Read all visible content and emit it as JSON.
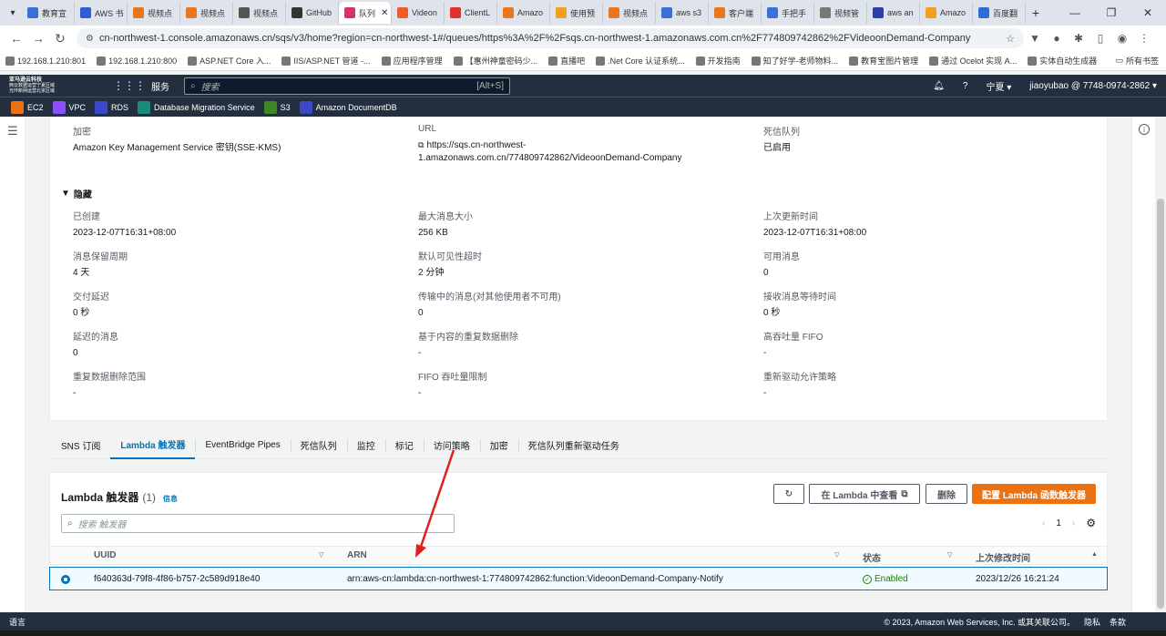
{
  "browser": {
    "tabs": [
      {
        "label": "教育宣",
        "color": "#3b6fd8"
      },
      {
        "label": "AWS 书",
        "color": "#2f5bd3"
      },
      {
        "label": "视频点",
        "color": "#e8761c"
      },
      {
        "label": "视频点",
        "color": "#e8761c"
      },
      {
        "label": "视频点",
        "color": "#555555"
      },
      {
        "label": "GitHub",
        "color": "#333333"
      },
      {
        "label": "队列",
        "color": "#d6336c",
        "active": true
      },
      {
        "label": "Videon",
        "color": "#f05a28"
      },
      {
        "label": "ClientL",
        "color": "#e03030"
      },
      {
        "label": "Amazo",
        "color": "#e8761c"
      },
      {
        "label": "使用预",
        "color": "#f0a020"
      },
      {
        "label": "视频点",
        "color": "#e8761c"
      },
      {
        "label": "aws s3",
        "color": "#3b6fd8"
      },
      {
        "label": "客户端",
        "color": "#e8761c"
      },
      {
        "label": "手把手",
        "color": "#3b6fd8"
      },
      {
        "label": "视频管",
        "color": "#777777"
      },
      {
        "label": "aws an",
        "color": "#2f3fa8"
      },
      {
        "label": "Amazo",
        "color": "#f0a020"
      },
      {
        "label": "百度翻",
        "color": "#2f6bd8"
      }
    ],
    "url": "cn-northwest-1.console.amazonaws.cn/sqs/v3/home?region=cn-northwest-1#/queues/https%3A%2F%2Fsqs.cn-northwest-1.amazonaws.com.cn%2F774809742862%2FVideoonDemand-Company",
    "bookmarks": [
      "192.168.1.210:801",
      "192.168.1.210:800",
      "ASP.NET Core 入...",
      "IIS/ASP.NET 管道 -...",
      "应用程序管理",
      "【惠州神童密码少...",
      "直播吧",
      ".Net Core 认证系统...",
      "开发指南",
      "知了好学-老师物料...",
      "教育宝图片管理",
      "通过 Ocelot 实现 A...",
      "实体自动生成器"
    ],
    "bookmarks_all": "所有书签"
  },
  "aws": {
    "logo_line1": "亚马逊云科技",
    "logo_line2": "西云数据运营宁夏区域",
    "logo_line3": "光环新网运营北京区域",
    "services": "服务",
    "search_placeholder": "搜索",
    "search_shortcut": "[Alt+S]",
    "region": "宁夏",
    "account": "jiaoyubao @ 7748-0974-2862",
    "shortcuts": [
      {
        "label": "EC2",
        "color": "#ec7211"
      },
      {
        "label": "VPC",
        "color": "#8c4fff"
      },
      {
        "label": "RDS",
        "color": "#3b48cc"
      },
      {
        "label": "Database Migration Service",
        "color": "#1a8a7a"
      },
      {
        "label": "S3",
        "color": "#3f8624"
      },
      {
        "label": "Amazon DocumentDB",
        "color": "#3b48cc"
      }
    ]
  },
  "details": {
    "top": {
      "encryption": {
        "key": "加密",
        "value": "Amazon Key Management Service 密钥(SSE-KMS)"
      },
      "url": {
        "key": "URL",
        "value_line1": "https://sqs.cn-northwest-",
        "value_line2": "1.amazonaws.com.cn/774809742862/VideoonDemand-Company"
      },
      "dlq": {
        "key": "死信队列",
        "value": "已启用"
      }
    },
    "section_title": "隐藏",
    "rows": [
      [
        {
          "key": "已创建",
          "value": "2023-12-07T16:31+08:00"
        },
        {
          "key": "最大消息大小",
          "value": "256 KB"
        },
        {
          "key": "上次更新时间",
          "value": "2023-12-07T16:31+08:00"
        }
      ],
      [
        {
          "key": "消息保留周期",
          "value": "4 天"
        },
        {
          "key": "默认可见性超时",
          "value": "2 分钟"
        },
        {
          "key": "可用消息",
          "value": "0"
        }
      ],
      [
        {
          "key": "交付延迟",
          "value": "0 秒"
        },
        {
          "key": "传输中的消息(对其他使用者不可用)",
          "value": "0"
        },
        {
          "key": "接收消息等待时间",
          "value": "0 秒"
        }
      ],
      [
        {
          "key": "延迟的消息",
          "value": "0"
        },
        {
          "key": "基于内容的重复数据删除",
          "value": "-"
        },
        {
          "key": "高吞吐量 FIFO",
          "value": "-"
        }
      ],
      [
        {
          "key": "重复数据删除范围",
          "value": "-"
        },
        {
          "key": "FIFO 吞吐量限制",
          "value": "-"
        },
        {
          "key": "重新驱动允许策略",
          "value": "-"
        }
      ]
    ]
  },
  "panel_tabs": [
    "SNS 订阅",
    "Lambda 触发器",
    "EventBridge Pipes",
    "死信队列",
    "监控",
    "标记",
    "访问策略",
    "加密",
    "死信队列重新驱动任务"
  ],
  "lambda": {
    "title": "Lambda 触发器",
    "count": "(1)",
    "info": "信息",
    "buttons": {
      "view": "在 Lambda 中查看",
      "delete": "删除",
      "configure": "配置 Lambda 函数触发器"
    },
    "filter_placeholder": "搜索 触发器",
    "page": "1",
    "columns": [
      "UUID",
      "ARN",
      "状态",
      "上次修改时间"
    ],
    "rows": [
      {
        "uuid": "f640363d-79f8-4f86-b757-2c589d918e40",
        "arn": "arn:aws-cn:lambda:cn-northwest-1:774809742862:function:VideoonDemand-Company-Notify",
        "status": "Enabled",
        "modified": "2023/12/26 16:21:24"
      }
    ]
  },
  "footer": {
    "language": "语言",
    "copyright": "© 2023, Amazon Web Services, Inc. 或其关联公司。",
    "privacy": "隐私",
    "terms": "条款"
  },
  "colors": {
    "accent": "#0073bb",
    "primary_button": "#ec7211",
    "header": "#232f3e",
    "success": "#1d8102",
    "annotation": "#e02020"
  }
}
